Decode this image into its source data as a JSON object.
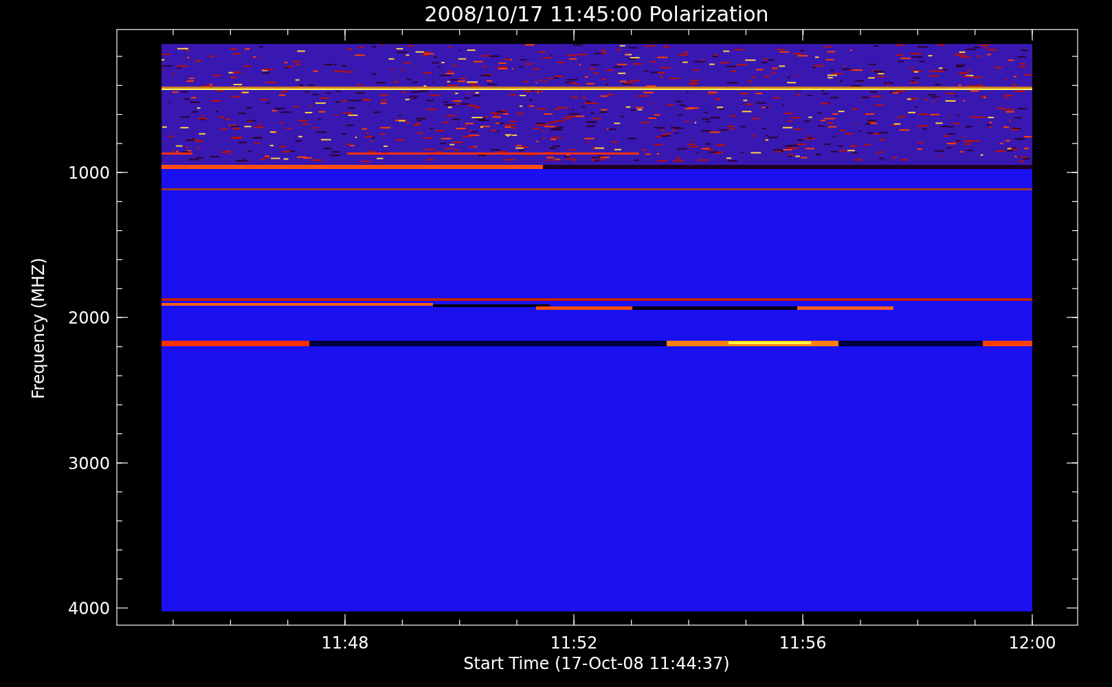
{
  "title": "2008/10/17 11:45:00 Polarization",
  "y_axis": {
    "label": "Frequency (MHZ)",
    "ticks": [
      "1000",
      "2000",
      "3000",
      "4000"
    ]
  },
  "x_axis": {
    "label": "Start Time (17-Oct-08 11:44:37)",
    "ticks": [
      "11:48",
      "11:52",
      "11:56",
      "12:00"
    ]
  }
}
